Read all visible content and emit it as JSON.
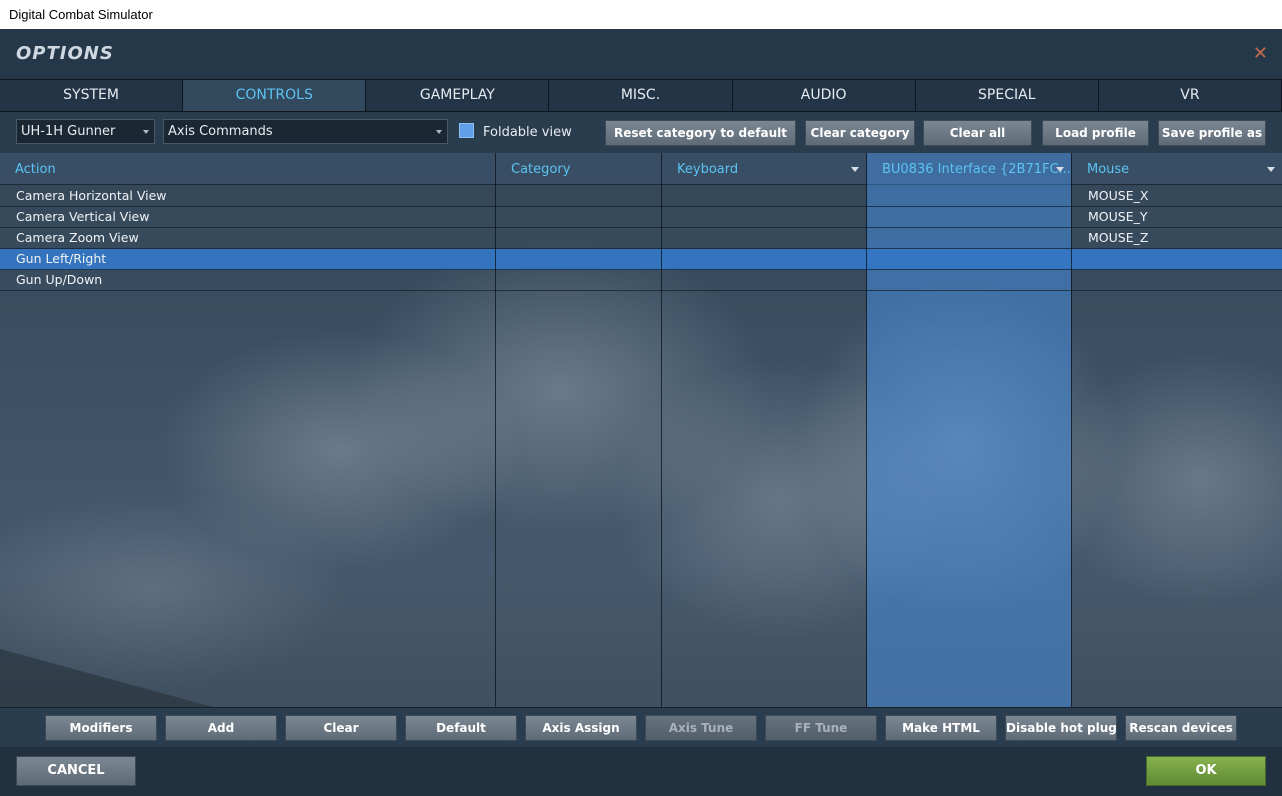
{
  "window": {
    "title": "Digital Combat Simulator"
  },
  "header": {
    "title": "OPTIONS",
    "close_icon": "close-icon"
  },
  "tabs": [
    {
      "label": "SYSTEM",
      "active": false
    },
    {
      "label": "CONTROLS",
      "active": true
    },
    {
      "label": "GAMEPLAY",
      "active": false
    },
    {
      "label": "MISC.",
      "active": false
    },
    {
      "label": "AUDIO",
      "active": false
    },
    {
      "label": "SPECIAL",
      "active": false
    },
    {
      "label": "VR",
      "active": false
    }
  ],
  "toolbar": {
    "aircraft_select": "UH-1H Gunner",
    "category_select": "Axis Commands",
    "foldable_view_label": "Foldable view",
    "foldable_view_checked": true,
    "reset_category_label": "Reset category to default",
    "clear_category_label": "Clear category",
    "clear_all_label": "Clear all",
    "load_profile_label": "Load profile",
    "save_profile_label": "Save profile as"
  },
  "grid": {
    "columns": [
      "Action",
      "Category",
      "Keyboard",
      "BU0836 Interface {2B71FC...",
      "Mouse"
    ],
    "rows": [
      {
        "action": "Camera Horizontal View",
        "category": "",
        "keyboard": "",
        "device": "",
        "mouse": "MOUSE_X",
        "selected": false
      },
      {
        "action": "Camera Vertical View",
        "category": "",
        "keyboard": "",
        "device": "",
        "mouse": "MOUSE_Y",
        "selected": false
      },
      {
        "action": "Camera Zoom View",
        "category": "",
        "keyboard": "",
        "device": "",
        "mouse": "MOUSE_Z",
        "selected": false
      },
      {
        "action": "Gun Left/Right",
        "category": "",
        "keyboard": "",
        "device": "",
        "mouse": "",
        "selected": true
      },
      {
        "action": "Gun Up/Down",
        "category": "",
        "keyboard": "",
        "device": "",
        "mouse": "",
        "selected": false
      }
    ]
  },
  "bottom_buttons": {
    "modifiers": "Modifiers",
    "add": "Add",
    "clear": "Clear",
    "default": "Default",
    "axis_assign": "Axis Assign",
    "axis_tune": "Axis Tune",
    "ff_tune": "FF Tune",
    "make_html": "Make HTML",
    "disable_hot_plug": "Disable hot plug",
    "rescan_devices": "Rescan devices"
  },
  "footer": {
    "cancel_label": "CANCEL",
    "ok_label": "OK"
  },
  "colors": {
    "accent": "#5cc3f2",
    "selection": "#3476c4",
    "device_column": "#468cdc",
    "ok_green": "#6f9c3f",
    "close": "#c06a4a"
  }
}
